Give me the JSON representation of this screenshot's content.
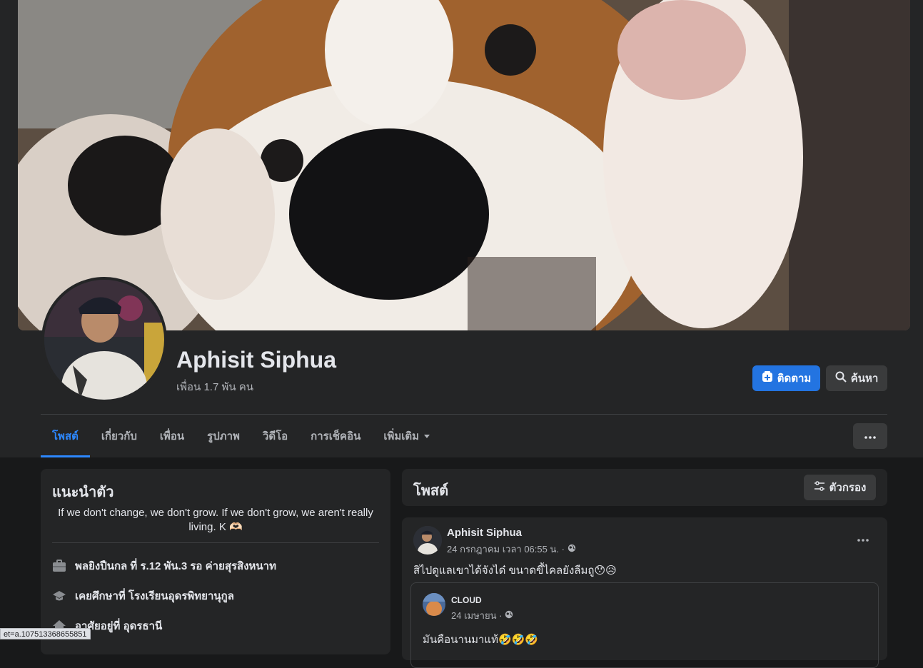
{
  "profile": {
    "name": "Aphisit Siphua",
    "friends": "เพื่อน 1.7 พัน คน"
  },
  "actions": {
    "follow_label": "ติดตาม",
    "search_label": "ค้นหา"
  },
  "tabs": [
    {
      "label": "โพสต์",
      "active": true
    },
    {
      "label": "เกี่ยวกับ"
    },
    {
      "label": "เพื่อน"
    },
    {
      "label": "รูปภาพ"
    },
    {
      "label": "วิดีโอ"
    },
    {
      "label": "การเช็คอิน"
    },
    {
      "label": "เพิ่มเติม"
    }
  ],
  "intro": {
    "title": "แนะนำตัว",
    "bio": "If we don't change, we don't grow. If we don't grow, we aren't really living. K 🫶🏻",
    "items": [
      {
        "icon": "briefcase-icon",
        "text": "พลยิงปืนกล ที่ ร.12 พัน.3 รอ ค่ายสุรสิงหนาท"
      },
      {
        "icon": "graduation-cap-icon",
        "text": "เคยศึกษาที่ โรงเรียนอุดรพิทยานุกูล"
      },
      {
        "icon": "home-icon",
        "text": "อาศัยอยู่ที่ อุดรธานี"
      }
    ]
  },
  "posts_section": {
    "title": "โพสต์",
    "filter_label": "ตัวกรอง"
  },
  "post": {
    "author": "Aphisit Siphua",
    "time": "24 กรกฎาคม เวลา 06:55 น. ·",
    "text": "สิไปดูแลเขาได้จังได๋ ขนาดขี้ไคลยังลืมถู😯😥",
    "shared": {
      "author": "CLOUD",
      "time": "24 เมษายน ·",
      "text": "มันคือนานมาแท้🤣🤣🤣"
    }
  },
  "status_bar": "et=a.107513368655851",
  "colors": {
    "accent": "#2374e1",
    "tab_active": "#2d88ff",
    "background": "#18191a",
    "card": "#242526"
  }
}
